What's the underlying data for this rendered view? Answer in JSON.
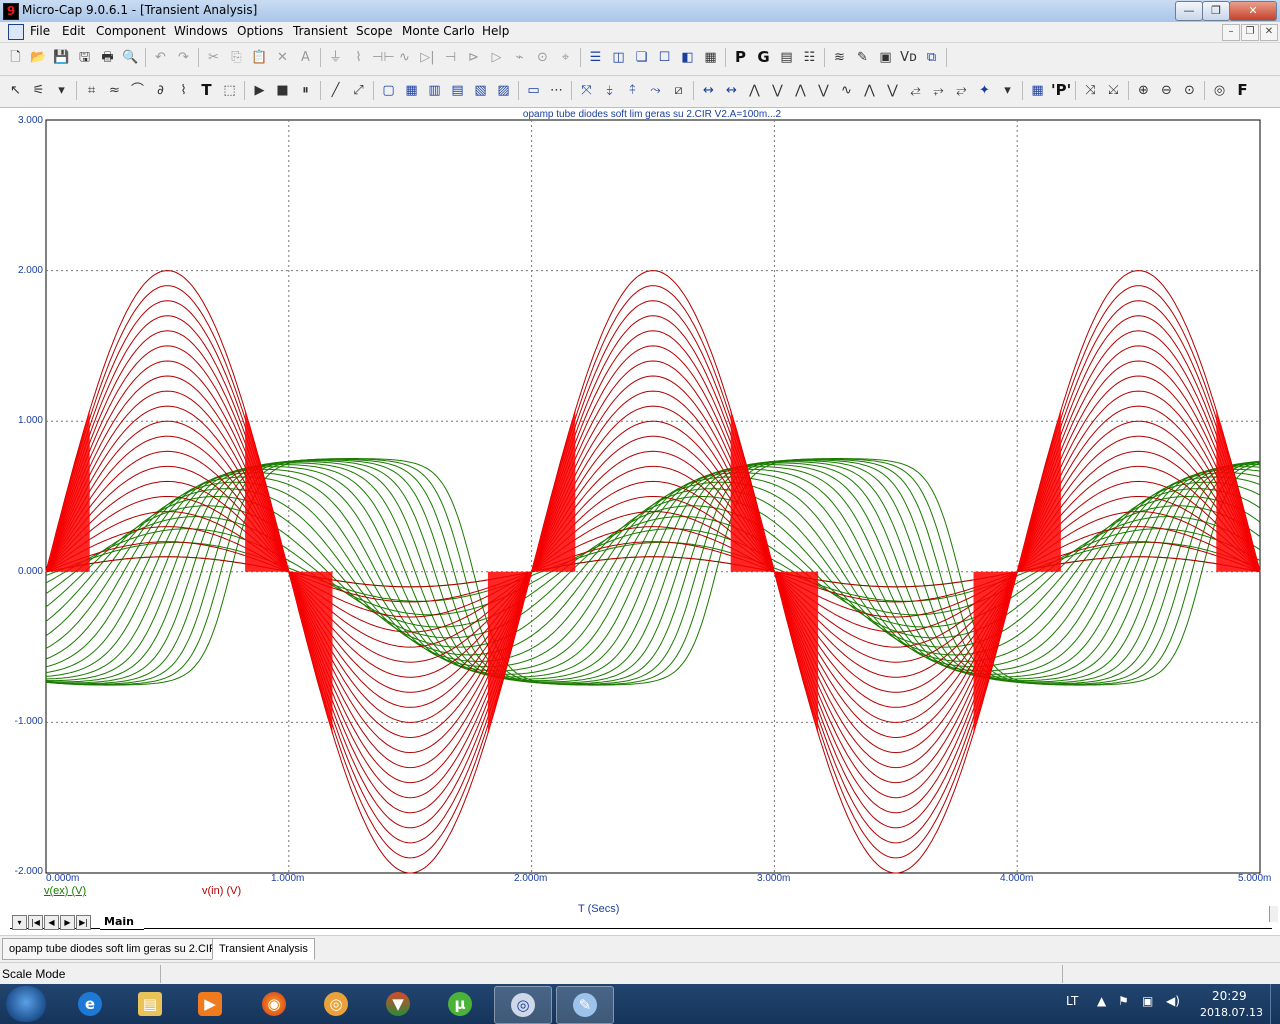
{
  "window": {
    "title": "Micro-Cap 9.0.6.1 - [Transient Analysis]",
    "min_glyph": "—",
    "max_glyph": "❐",
    "close_glyph": "✕"
  },
  "menu": [
    "File",
    "Edit",
    "Component",
    "Windows",
    "Options",
    "Transient",
    "Scope",
    "Monte Carlo",
    "Help"
  ],
  "toolbar1_icons": [
    "new-icon",
    "open-icon",
    "save-icon",
    "save-all-icon",
    "print-icon",
    "print-preview-icon",
    "undo-icon",
    "redo-icon",
    "cut-icon",
    "copy-icon",
    "paste-icon",
    "delete-icon",
    "text-mode-icon",
    "ground-icon",
    "resistor-icon",
    "capacitor-icon",
    "inductor-icon",
    "diode-icon",
    "battery-icon",
    "npn-icon",
    "opamp-icon",
    "switch-icon",
    "source-icon",
    "pin-icon",
    "tile-horizontal-icon",
    "tile-vertical-icon",
    "cascade-icon",
    "window-icon",
    "split-icon",
    "calculator-icon",
    "p-icon",
    "g-icon",
    "grid-icon",
    "properties-icon",
    "waveform-icon",
    "probe-icon",
    "picture-icon",
    "vd-icon",
    "zoom-window-icon"
  ],
  "toolbar1_glyphs": [
    "🗋",
    "📂",
    "💾",
    "🖫",
    "🖶",
    "🔍",
    "↶",
    "↷",
    "✂",
    "⎘",
    "📋",
    "✕",
    "A",
    "⏚",
    "⌇",
    "⊣⊢",
    "∿",
    "▷|",
    "⊣",
    "⊳",
    "▷",
    "⌁",
    "⊙",
    "⌖",
    "☰",
    "◫",
    "❏",
    "☐",
    "◧",
    "▦",
    "P",
    "G",
    "▤",
    "☷",
    "≋",
    "✎",
    "▣",
    "Vᴅ",
    "⧉"
  ],
  "toolbar2_icons": [
    "select-icon",
    "component-icon",
    "dropdown-icon",
    "wire-icon",
    "text-icon",
    "info-icon",
    "help-icon",
    "formula-icon",
    "T-text-icon",
    "tag-icon",
    "run-icon",
    "stop-icon",
    "pause-icon",
    "line-icon",
    "diagonal-icon",
    "box-icon",
    "table-icon",
    "pattern-icon",
    "pattern-2-icon",
    "pattern-3-icon",
    "pattern-4-icon",
    "hline-icon",
    "tokens-icon",
    "cursor-icon",
    "cursor-2-icon",
    "cursor-3-icon",
    "cursor-4-icon",
    "auto-scale-icon",
    "left-arrow-icon",
    "right-arrow-icon",
    "peak-icon",
    "valley-icon",
    "high-icon",
    "low-icon",
    "inflection-icon",
    "global-high-icon",
    "global-low-icon",
    "slope-icon",
    "next-icon",
    "prev-icon",
    "box-zoom-icon",
    "dropdown-2-icon",
    "table-2-icon",
    "P-label-icon",
    "pan-icon",
    "pan-2-icon",
    "zoom-in-icon",
    "zoom-out-icon",
    "zoom-fit-icon",
    "settings-icon",
    "F-icon"
  ],
  "toolbar2_glyphs": [
    "↖",
    "⚟",
    "▾",
    "⌗",
    "≈",
    "⌒",
    "∂",
    "⌇",
    "T",
    "⬚",
    "▶",
    "■",
    "⏸",
    "╱",
    "⤢",
    "▢",
    "▦",
    "▥",
    "▤",
    "▧",
    "▨",
    "▭",
    "⋯",
    "⤧",
    "⤈",
    "⤉",
    "⤳",
    "⧄",
    "↔",
    "↔",
    "⋀",
    "⋁",
    "⋀",
    "⋁",
    "∿",
    "⋀",
    "⋁",
    "⥄",
    "⥅",
    "⥂",
    "✦",
    "▾",
    "▦",
    "'P'",
    "⤨",
    "⤩",
    "⊕",
    "⊖",
    "⊙",
    "◎",
    "F"
  ],
  "plot": {
    "title": "opamp tube diodes soft lim geras su 2.CIR V2.A=100m...2",
    "x_label": "T (Secs)",
    "y_ticks": [
      "3.000",
      "2.000",
      "1.000",
      "0.000",
      "-1.000",
      "-2.000"
    ],
    "x_ticks": [
      "0.000m",
      "1.000m",
      "2.000m",
      "3.000m",
      "4.000m",
      "5.000m"
    ],
    "legend_ex": "v(ex) (V)",
    "legend_in": "v(in) (V)",
    "tab_label": "Main"
  },
  "chart_data": {
    "type": "line",
    "title": "opamp tube diodes soft lim geras su 2.CIR V2.A=100m...2",
    "xlabel": "T (Secs)",
    "ylabel": "",
    "xlim": [
      0,
      0.005
    ],
    "ylim": [
      -2,
      3
    ],
    "x_tick_labels": [
      "0.000m",
      "1.000m",
      "2.000m",
      "3.000m",
      "4.000m",
      "5.000m"
    ],
    "y_tick_labels": [
      "3.000",
      "2.000",
      "1.000",
      "0.000",
      "-1.000",
      "-2.000"
    ],
    "grid": true,
    "frequency_hz": 500,
    "stepped_parameter": {
      "name": "V2.A",
      "from": 0.1,
      "to": 2.0,
      "step": 0.1
    },
    "series": [
      {
        "name": "v(in) (V)",
        "color": "#b30000",
        "shape": "sine",
        "amplitudes": [
          0.1,
          0.2,
          0.3,
          0.4,
          0.5,
          0.6,
          0.7,
          0.8,
          0.9,
          1.0,
          1.1,
          1.2,
          1.3,
          1.4,
          1.5,
          1.6,
          1.7,
          1.8,
          1.9,
          2.0
        ]
      },
      {
        "name": "v(ex) (V)",
        "color": "#1a7a00",
        "shape": "soft-limited sine",
        "saturation_level": 0.76,
        "phase_shift_per_step_ms": 0.04
      }
    ]
  },
  "colors": {
    "vin": "#b30000",
    "vex": "#1a7a00",
    "vin_zero_crossing": "#ff0000",
    "axis_text": "#1a3ea0"
  },
  "doc_tabs": [
    "opamp tube diodes soft lim geras su 2.CIR",
    "Transient Analysis"
  ],
  "status": "Scale  Mode",
  "taskbar": {
    "apps": [
      "ie-icon",
      "explorer-icon",
      "media-icon",
      "firefox-icon",
      "eye-icon",
      "shield-icon",
      "utorrent-icon",
      "microcap-icon",
      "paint-icon"
    ],
    "lang": "LT",
    "time": "20:29",
    "date": "2018.07.13"
  }
}
